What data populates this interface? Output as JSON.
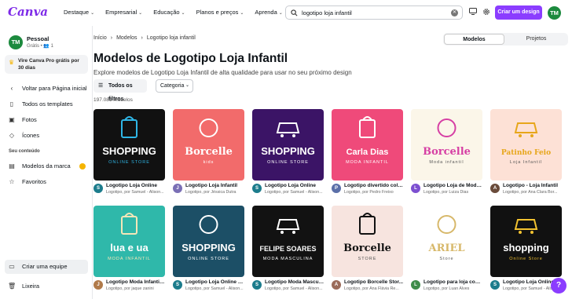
{
  "app": {
    "logo": "Canva"
  },
  "nav": [
    "Destaque",
    "Empresarial",
    "Educação",
    "Planos e preços",
    "Aprenda"
  ],
  "search": {
    "query": "logotipo loja infantil"
  },
  "create_button": "Criar um design",
  "user_initials": "TM",
  "sidebar": {
    "account_name": "Pessoal",
    "account_sub": "Grátis • 👥 1",
    "promo": "Vire Canva Pro grátis por 30 dias",
    "items": [
      {
        "label": "Voltar para Página inicial",
        "icon": "chevron-left-icon"
      },
      {
        "label": "Todos os templates",
        "icon": "template-icon"
      },
      {
        "label": "Fotos",
        "icon": "photo-icon"
      },
      {
        "label": "Ícones",
        "icon": "shapes-icon"
      }
    ],
    "section_heading": "Seu conteúdo",
    "content_items": [
      {
        "label": "Modelos da marca",
        "icon": "brand-icon"
      },
      {
        "label": "Favoritos",
        "icon": "star-icon"
      }
    ],
    "invite": "Criar uma equipe",
    "trash": "Lixeira"
  },
  "breadcrumb": [
    "Início",
    "Modelos",
    "Logotipo loja infantil"
  ],
  "tabs": [
    "Modelos",
    "Projetos"
  ],
  "page": {
    "title": "Modelos de Logotipo Loja Infantil",
    "description": "Explore modelos de Logotipo Loja Infantil de alta qualidade para usar no seu próximo design",
    "filters_button": "Todos os filtros",
    "category_button": "Categoria",
    "result_count": "197.081 modelos"
  },
  "templates": [
    {
      "title": "Logotipo Loja Online",
      "author": "Logotipo, por Samuel - Alison...",
      "avatar": "S",
      "avatar_color": "#1c7c8c",
      "art": {
        "bg": "#111111",
        "big": "SHOPPING",
        "small": "ONLINE STORE",
        "accent": "#2fb6e6"
      }
    },
    {
      "title": "Logotipo Loja Infantil",
      "author": "Logotipo, por Jéssica Dutra",
      "avatar": "J",
      "avatar_color": "#7a6fb5",
      "art": {
        "bg": "#f26b6b",
        "big": "Borcelle",
        "small": "kids",
        "accent": "#ffffff"
      }
    },
    {
      "title": "Logotipo Loja Online",
      "author": "Logotipo, por Samuel - Alison...",
      "avatar": "S",
      "avatar_color": "#1c7c8c",
      "art": {
        "bg": "#3b1466",
        "big": "SHOPPING",
        "small": "ONLINE STORE",
        "accent": "#ffffff"
      }
    },
    {
      "title": "Logotipo divertido colo...",
      "author": "Logotipo, por Pedro Freixo",
      "avatar": "P",
      "avatar_color": "#5b6fa8",
      "art": {
        "bg": "#ef4a7a",
        "big": "Carla Dias",
        "small": "MODA INFANTIL",
        "accent": "#ffffff"
      }
    },
    {
      "title": "Logotipo Loja de Moda ...",
      "author": "Logotipo, por Luiza Dias",
      "avatar": "L",
      "avatar_color": "#7c4fd0",
      "art": {
        "bg": "#fbf6e9",
        "big": "Borcelle",
        "small": "Moda infantil",
        "accent": "#d63fa4"
      }
    },
    {
      "title": "Logotipo - Loja Infantil",
      "author": "Logotipo, por Ana Clara Bor...",
      "avatar": "A",
      "avatar_color": "#6a4b3a",
      "art": {
        "bg": "#fde1d6",
        "big": "Patinho Feio",
        "small": "Loja Infantil",
        "accent": "#e7a61a"
      }
    },
    {
      "title": "Logotipo Moda Infantil ...",
      "author": "Logotipo, por jaque zanini",
      "avatar": "J",
      "avatar_color": "#b07a4a",
      "art": {
        "bg": "#2fb8aa",
        "big": "lua e ua",
        "small": "MODA INFANTIL",
        "accent": "#f4e6b8"
      }
    },
    {
      "title": "Logotipo Loja Online B...",
      "author": "Logotipo, por Samuel - Alison...",
      "avatar": "S",
      "avatar_color": "#1c7c8c",
      "art": {
        "bg": "#1c4f66",
        "big": "SHOPPING",
        "small": "ONLINE STORE",
        "accent": "#ffffff"
      }
    },
    {
      "title": "Logotipo Moda Masculi...",
      "author": "Logotipo, por Samuel - Alison...",
      "avatar": "S",
      "avatar_color": "#1c7c8c",
      "art": {
        "bg": "#121212",
        "big": "FELIPE SOARES",
        "small": "MODA MASCULINA",
        "accent": "#ffffff"
      }
    },
    {
      "title": "Logotipo Borcelle Stor...",
      "author": "Logotipo, por Ana Flávia Re...",
      "avatar": "A",
      "avatar_color": "#9a6b5a",
      "art": {
        "bg": "#f7e4df",
        "big": "Borcelle",
        "small": "STORE",
        "accent": "#111111"
      }
    },
    {
      "title": "Logotipo para loja com...",
      "author": "Logotipo, por Luan Alves",
      "avatar": "L",
      "avatar_color": "#3f8c4a",
      "art": {
        "bg": "#ffffff",
        "big": "ARIEL",
        "small": "Store",
        "accent": "#d7b86a"
      }
    },
    {
      "title": "Logotipo Loja Online",
      "author": "Logotipo, por Samuel - Alison...",
      "avatar": "S",
      "avatar_color": "#1c7c8c",
      "art": {
        "bg": "#111111",
        "big": "shopping",
        "small": "Online Store",
        "accent": "#f2c230"
      }
    }
  ]
}
